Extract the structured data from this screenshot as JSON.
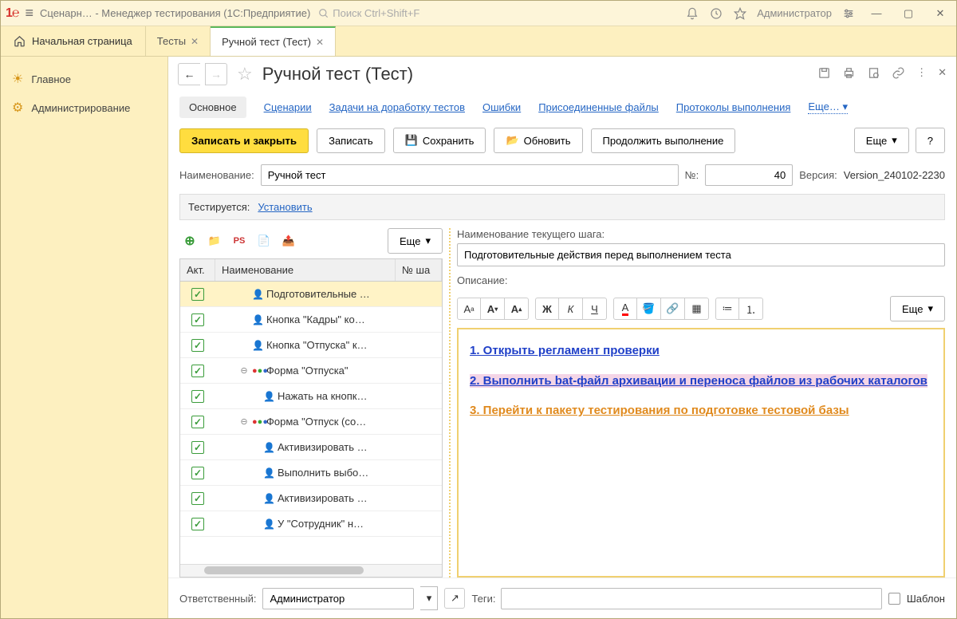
{
  "titlebar": {
    "app": "Сценарн…   - Менеджер тестирования (1С:Предприятие)",
    "search_placeholder": "Поиск Ctrl+Shift+F",
    "user": "Администратор"
  },
  "tabs": {
    "home": "Начальная страница",
    "items": [
      {
        "label": "Тесты",
        "active": false
      },
      {
        "label": "Ручной тест (Тест)",
        "active": true
      }
    ]
  },
  "sidebar": {
    "items": [
      {
        "icon": "sun",
        "label": "Главное"
      },
      {
        "icon": "gear",
        "label": "Администрирование"
      }
    ]
  },
  "page": {
    "title": "Ручной тест (Тест)"
  },
  "linkbar": {
    "main": "Основное",
    "links": [
      "Сценарии",
      "Задачи на доработку тестов",
      "Ошибки",
      "Присоединенные файлы",
      "Протоколы выполнения"
    ],
    "more": "Еще…"
  },
  "toolbar": {
    "save_close": "Записать и закрыть",
    "save": "Записать",
    "save_file": "Сохранить",
    "refresh": "Обновить",
    "continue": "Продолжить выполнение",
    "more": "Еще",
    "help": "?"
  },
  "fields": {
    "name_label": "Наименование:",
    "name_value": "Ручной тест",
    "num_label": "№:",
    "num_value": "40",
    "version_label": "Версия:",
    "version_value": "Version_240102-2230"
  },
  "tested": {
    "label": "Тестируется:",
    "link": "Установить"
  },
  "left_tb": {
    "more": "Еще"
  },
  "grid": {
    "headers": {
      "c1": "Акт.",
      "c2": "Наименование",
      "c3": "№ ша"
    },
    "rows": [
      {
        "sel": true,
        "indent": 1,
        "icon": "person",
        "toggle": "",
        "name": "Подготовительные …"
      },
      {
        "sel": false,
        "indent": 1,
        "icon": "person",
        "toggle": "",
        "name": "Кнопка \"Кадры\" ко…"
      },
      {
        "sel": false,
        "indent": 1,
        "icon": "person",
        "toggle": "",
        "name": "Кнопка \"Отпуска\" к…"
      },
      {
        "sel": false,
        "indent": 1,
        "icon": "dots",
        "toggle": "⊖",
        "name": "Форма \"Отпуска\""
      },
      {
        "sel": false,
        "indent": 2,
        "icon": "person",
        "toggle": "",
        "name": "Нажать на кнопк…"
      },
      {
        "sel": false,
        "indent": 1,
        "icon": "dots",
        "toggle": "⊖",
        "name": "Форма \"Отпуск (со…"
      },
      {
        "sel": false,
        "indent": 2,
        "icon": "person",
        "toggle": "",
        "name": "Активизировать …"
      },
      {
        "sel": false,
        "indent": 2,
        "icon": "person",
        "toggle": "",
        "name": "Выполнить выбо…"
      },
      {
        "sel": false,
        "indent": 2,
        "icon": "person",
        "toggle": "",
        "name": "Активизировать …"
      },
      {
        "sel": false,
        "indent": 2,
        "icon": "person",
        "toggle": "",
        "name": "У  \"Сотрудник\" н…"
      }
    ]
  },
  "right": {
    "step_name_label": "Наименование текущего шага:",
    "step_name_value": "Подготовительные действия перед выполнением теста",
    "desc_label": "Описание:",
    "more": "Еще",
    "content": {
      "l1": "1. Открыть регламент проверки",
      "l2": "2. Выполнить bat-файл архивации и переноса файлов из рабочих каталогов",
      "l3": "3. Перейти к пакету тестирования по подготовке тестовой базы"
    }
  },
  "footer": {
    "resp_label": "Ответственный:",
    "resp_value": "Администратор",
    "tags_label": "Теги:",
    "template_label": "Шаблон"
  }
}
